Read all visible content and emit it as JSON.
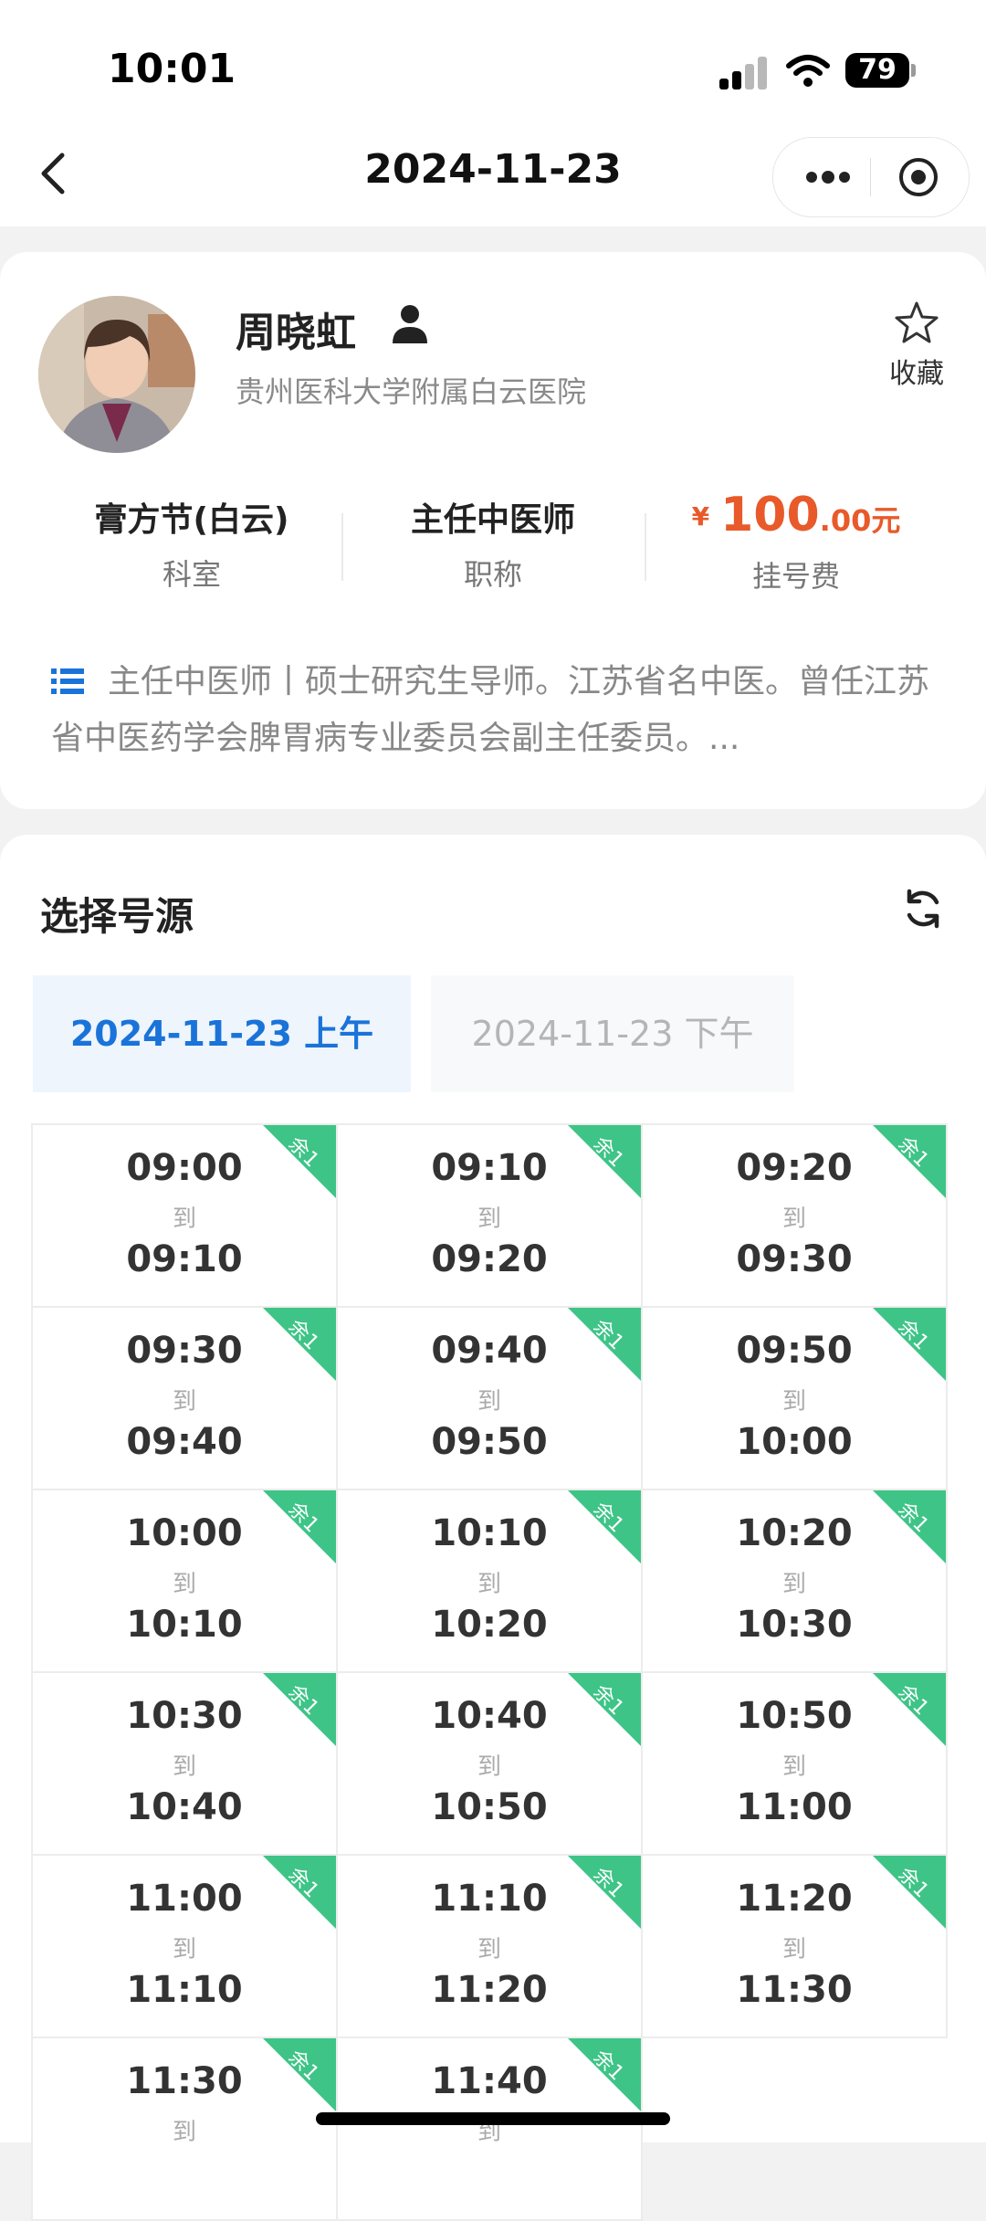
{
  "status_bar": {
    "time": "10:01",
    "battery": "79"
  },
  "nav": {
    "title": "2024-11-23"
  },
  "doctor": {
    "name": "周晓虹",
    "hospital": "贵州医科大学附属白云医院",
    "favorite_label": "收藏",
    "stats": [
      {
        "value": "膏方节(白云)",
        "label": "科室"
      },
      {
        "value": "主任中医师",
        "label": "职称"
      }
    ],
    "fee": {
      "currency": "¥",
      "integer": "100",
      "decimal": ".00元",
      "label": "挂号费"
    },
    "intro": "主任中医师丨硕士研究生导师。江苏省名中医。曾任江苏省中医药学会脾胃病专业委员会副主任委员。..."
  },
  "schedule": {
    "title": "选择号源",
    "tabs": [
      {
        "label": "2024-11-23 上午",
        "active": true
      },
      {
        "label": "2024-11-23 下午",
        "active": false
      }
    ],
    "to_label": "到",
    "slots": [
      {
        "start": "09:00",
        "end": "09:10",
        "badge": "余1"
      },
      {
        "start": "09:10",
        "end": "09:20",
        "badge": "余1"
      },
      {
        "start": "09:20",
        "end": "09:30",
        "badge": "余1"
      },
      {
        "start": "09:30",
        "end": "09:40",
        "badge": "余1"
      },
      {
        "start": "09:40",
        "end": "09:50",
        "badge": "余1"
      },
      {
        "start": "09:50",
        "end": "10:00",
        "badge": "余1"
      },
      {
        "start": "10:00",
        "end": "10:10",
        "badge": "余1"
      },
      {
        "start": "10:10",
        "end": "10:20",
        "badge": "余1"
      },
      {
        "start": "10:20",
        "end": "10:30",
        "badge": "余1"
      },
      {
        "start": "10:30",
        "end": "10:40",
        "badge": "余1"
      },
      {
        "start": "10:40",
        "end": "10:50",
        "badge": "余1"
      },
      {
        "start": "10:50",
        "end": "11:00",
        "badge": "余1"
      },
      {
        "start": "11:00",
        "end": "11:10",
        "badge": "余1"
      },
      {
        "start": "11:10",
        "end": "11:20",
        "badge": "余1"
      },
      {
        "start": "11:20",
        "end": "11:30",
        "badge": "余1"
      },
      {
        "start": "11:30",
        "end": "",
        "badge": "余1"
      },
      {
        "start": "11:40",
        "end": "",
        "badge": "余1"
      }
    ]
  },
  "colors": {
    "accent_blue": "#1a73d9",
    "badge_green": "#3ec487",
    "fee_orange": "#e85a2a"
  }
}
